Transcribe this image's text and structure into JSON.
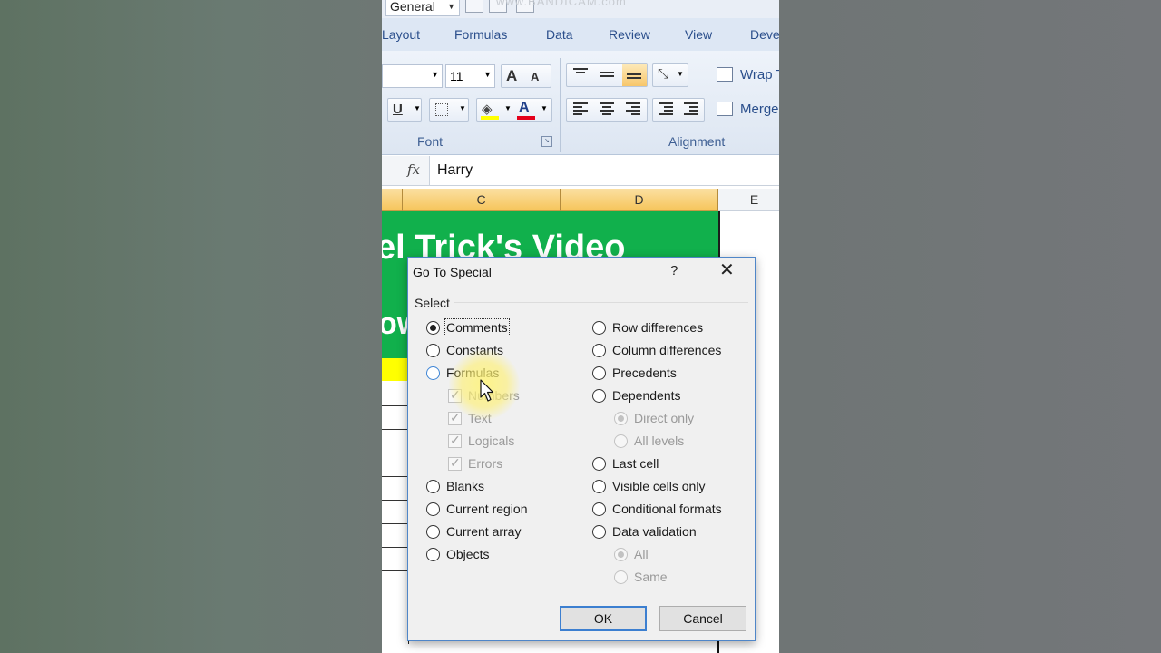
{
  "ribbon": {
    "number_format": "General",
    "watermark": "www.BANDICAM.com",
    "tabs": [
      "Layout",
      "Formulas",
      "Data",
      "Review",
      "View",
      "Deve"
    ],
    "font_size": "11",
    "font_group_label": "Font",
    "alignment_group_label": "Alignment",
    "wrap_text": "Wrap T",
    "merge": "Merge",
    "underline": "U",
    "font_color_letter": "A",
    "grow_font": "A",
    "shrink_font": "A"
  },
  "formula_bar": {
    "fx": "fx",
    "value": "Harry"
  },
  "sheet": {
    "columns": [
      "C",
      "D",
      "E"
    ],
    "banner_line1": "el Trick's Video",
    "banner_line2": "ow",
    "colors": {
      "banner": "#11b04c",
      "header_highlight": "#f6c55b",
      "yellow_cell": "#ffff00"
    }
  },
  "dialog": {
    "title": "Go To Special",
    "help": "?",
    "close": "✕",
    "section_label": "Select",
    "left_options": [
      {
        "label": "Comments",
        "checked": true
      },
      {
        "label": "Constants",
        "checked": false
      },
      {
        "label": "Formulas",
        "checked": false
      },
      {
        "label": "Numbers",
        "sub": true
      },
      {
        "label": "Text",
        "sub": true
      },
      {
        "label": "Logicals",
        "sub": true
      },
      {
        "label": "Errors",
        "sub": true
      },
      {
        "label": "Blanks",
        "checked": false
      },
      {
        "label": "Current region",
        "checked": false
      },
      {
        "label": "Current array",
        "checked": false
      },
      {
        "label": "Objects",
        "checked": false
      }
    ],
    "right_options": [
      {
        "label": "Row differences"
      },
      {
        "label": "Column differences"
      },
      {
        "label": "Precedents"
      },
      {
        "label": "Dependents"
      },
      {
        "label": "Direct only",
        "sub": true,
        "checked": true
      },
      {
        "label": "All levels",
        "sub": true
      },
      {
        "label": "Last cell"
      },
      {
        "label": "Visible cells only"
      },
      {
        "label": "Conditional formats"
      },
      {
        "label": "Data validation"
      },
      {
        "label": "All",
        "sub": true,
        "checked": true
      },
      {
        "label": "Same",
        "sub": true
      }
    ],
    "ok_label": "OK",
    "cancel_label": "Cancel"
  }
}
